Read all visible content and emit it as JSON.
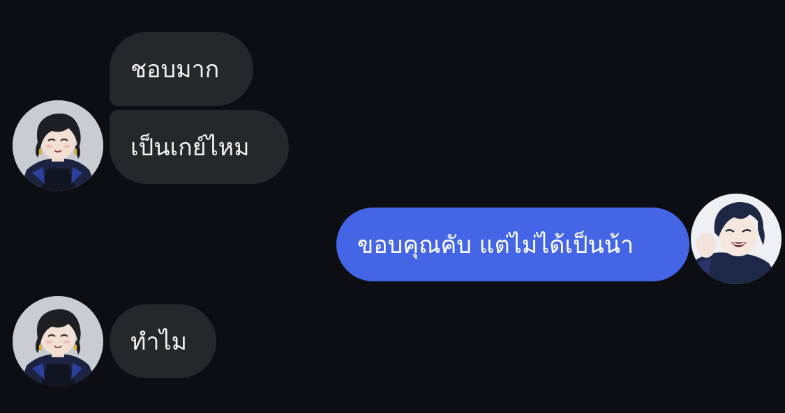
{
  "conversation": {
    "messages": [
      {
        "sender": "other",
        "text": "ชอบมาก"
      },
      {
        "sender": "other",
        "text": "เป็นเกย์ไหม"
      },
      {
        "sender": "me",
        "text": "ขอบคุณคับ แต่ไม่ได้เป็นน้า"
      },
      {
        "sender": "other",
        "text": "ทำไม"
      }
    ]
  },
  "colors": {
    "background": "#0c0e13",
    "incoming_bubble": "#25272b",
    "outgoing_bubble": "#4466e6"
  }
}
